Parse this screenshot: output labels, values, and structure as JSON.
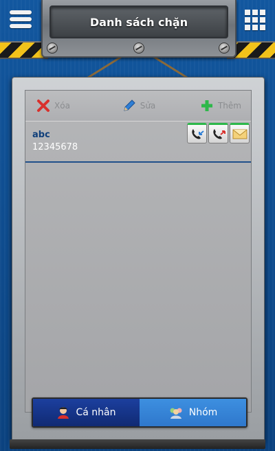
{
  "header": {
    "title": "Danh sách chặn",
    "menu_icon": "menu-icon",
    "grid_icon": "app-grid-icon"
  },
  "toolbar": {
    "delete_label": "Xóa",
    "edit_label": "Sửa",
    "add_label": "Thêm"
  },
  "entries": [
    {
      "name": "abc",
      "number": "12345678"
    }
  ],
  "entry_actions": [
    "incoming-call-block-icon",
    "outgoing-call-block-icon",
    "sms-block-icon"
  ],
  "tabs": [
    {
      "label": "Cá nhân",
      "icon": "person-icon",
      "active": true
    },
    {
      "label": "Nhóm",
      "icon": "group-icon",
      "active": false
    }
  ],
  "colors": {
    "background": "#0d4a8f",
    "active_tab": "#1c3f9e",
    "inactive_tab": "#3d8fe0",
    "name_text": "#0f3f7a",
    "accent_green": "#2db84a",
    "delete_red": "#d9302c"
  }
}
